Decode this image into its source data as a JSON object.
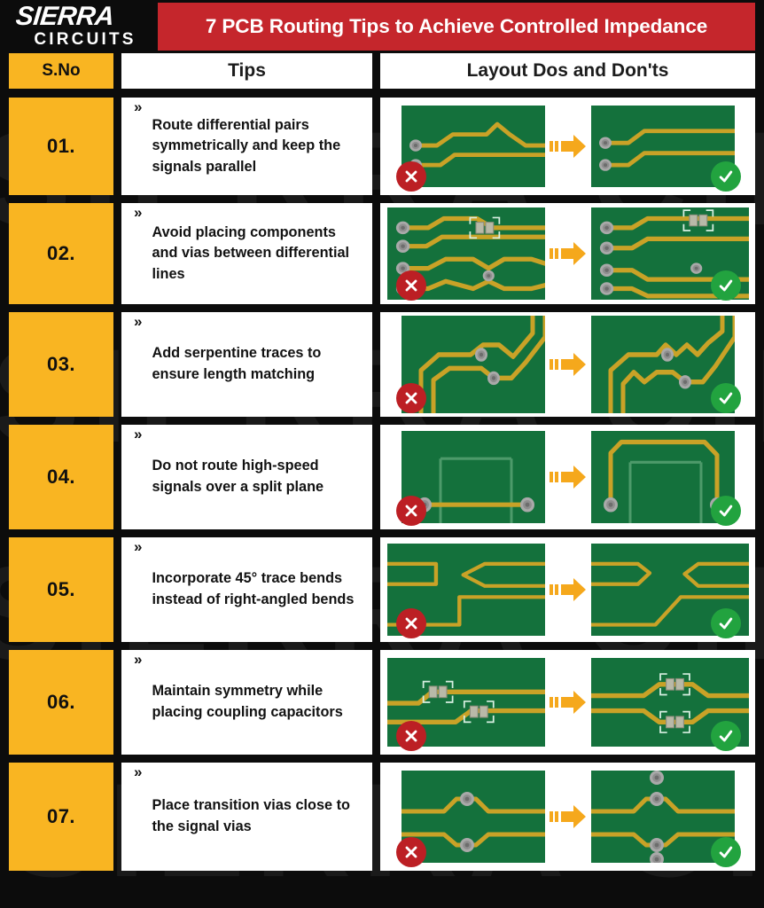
{
  "brand": {
    "logo_main": "SIERRA",
    "logo_sub": "CIRCUITS",
    "watermark_text": "SIERRA CIRCUITS",
    "colors": {
      "background": "#0c0c0c",
      "title_banner": "#c5262c",
      "accent_amber": "#f9b522",
      "cell_white": "#ffffff",
      "pcb_green": "#14713c",
      "trace_gold": "#c9a227",
      "badge_error": "#bc1f24",
      "badge_ok": "#22a33f",
      "arrow_orange": "#f5a81c"
    }
  },
  "header": {
    "title": "7 PCB Routing Tips to Achieve Controlled Impedance"
  },
  "table": {
    "columns": [
      "S.No",
      "Tips",
      "Layout Dos and Don'ts"
    ],
    "rows": [
      {
        "no": "01.",
        "bullet": "»",
        "tip": "Route differential pairs symmetrically and keep the signals parallel",
        "dont_label": "don't",
        "do_label": "do",
        "diagram": "diff-pair-symmetry"
      },
      {
        "no": "02.",
        "bullet": "»",
        "tip": "Avoid placing components and vias between differential lines",
        "dont_label": "don't",
        "do_label": "do",
        "diagram": "components-between-lines"
      },
      {
        "no": "03.",
        "bullet": "»",
        "tip": "Add serpentine traces to ensure length matching",
        "dont_label": "don't",
        "do_label": "do",
        "diagram": "serpentine-length-match"
      },
      {
        "no": "04.",
        "bullet": "»",
        "tip": "Do not route high-speed signals over a split plane",
        "dont_label": "don't",
        "do_label": "do",
        "diagram": "split-plane-crossing"
      },
      {
        "no": "05.",
        "bullet": "»",
        "tip": "Incorporate 45° trace bends instead of right-angled bends",
        "dont_label": "don't",
        "do_label": "do",
        "diagram": "forty-five-degree-bends"
      },
      {
        "no": "06.",
        "bullet": "»",
        "tip": "Maintain symmetry while placing coupling capacitors",
        "dont_label": "don't",
        "do_label": "do",
        "diagram": "coupling-capacitor-symmetry"
      },
      {
        "no": "07.",
        "bullet": "»",
        "tip": "Place transition vias close to the signal vias",
        "dont_label": "don't",
        "do_label": "do",
        "diagram": "transition-vias-placement"
      }
    ]
  },
  "icons": {
    "error": "cross-circle-icon",
    "ok": "check-circle-icon",
    "arrow": "right-arrow-icon"
  }
}
